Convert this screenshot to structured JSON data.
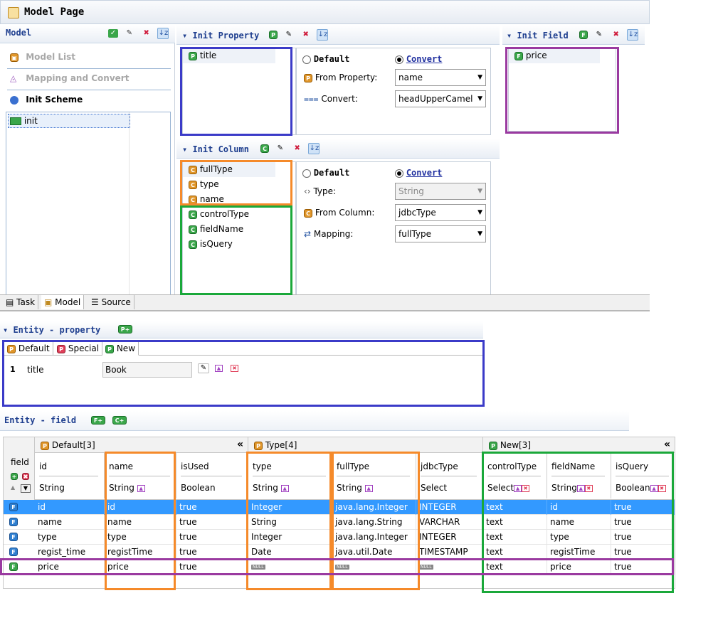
{
  "title": "Model Page",
  "model": {
    "header": "Model",
    "nav": [
      "Model List",
      "Mapping and Convert",
      "Init Scheme"
    ],
    "list": [
      "init"
    ]
  },
  "init_property": {
    "header": "Init Property",
    "items": [
      "title"
    ],
    "default_label": "Default",
    "convert_label": "Convert",
    "from_property_label": "From Property:",
    "from_property_value": "name",
    "convert_field_label": "Convert:",
    "convert_value": "headUpperCamel"
  },
  "init_field": {
    "header": "Init Field",
    "items": [
      "price"
    ]
  },
  "init_column": {
    "header": "Init Column",
    "items_p": [
      "fullType",
      "type",
      "name"
    ],
    "items_c": [
      "controlType",
      "fieldName",
      "isQuery"
    ],
    "default_label": "Default",
    "convert_label": "Convert",
    "type_label": "Type:",
    "type_value": "String",
    "from_column_label": "From Column:",
    "from_column_value": "jdbcType",
    "mapping_label": "Mapping:",
    "mapping_value": "fullType"
  },
  "bottom_tabs": [
    "Task",
    "Model",
    "Source"
  ],
  "entity_property": {
    "header": "Entity - property",
    "tabs": [
      "Default",
      "Special",
      "New"
    ],
    "row_index": "1",
    "row_name": "title",
    "row_value": "Book"
  },
  "entity_field": {
    "header": "Entity - field",
    "field_label": "field",
    "groups": [
      {
        "label": "Default[3]",
        "collapse": "«"
      },
      {
        "label": "Type[4]"
      },
      {
        "label": "New[3]",
        "collapse": "«"
      }
    ],
    "columns": [
      {
        "name": "id",
        "type": "String"
      },
      {
        "name": "name",
        "type": "String"
      },
      {
        "name": "isUsed",
        "type": "Boolean"
      },
      {
        "name": "type",
        "type": "String"
      },
      {
        "name": "fullType",
        "type": "String"
      },
      {
        "name": "jdbcType",
        "type": "Select"
      },
      {
        "name": "controlType",
        "type": "Select"
      },
      {
        "name": "fieldName",
        "type": "String"
      },
      {
        "name": "isQuery",
        "type": "Boolean"
      }
    ],
    "null_text": "NULL",
    "rows": [
      [
        "id",
        "id",
        "true",
        "Integer",
        "java.lang.Integer",
        "INTEGER",
        "text",
        "id",
        "true"
      ],
      [
        "name",
        "name",
        "true",
        "String",
        "java.lang.String",
        "VARCHAR",
        "text",
        "name",
        "true"
      ],
      [
        "type",
        "type",
        "true",
        "Integer",
        "java.lang.Integer",
        "INTEGER",
        "text",
        "type",
        "true"
      ],
      [
        "regist_time",
        "registTime",
        "true",
        "Date",
        "java.util.Date",
        "TIMESTAMP",
        "text",
        "registTime",
        "true"
      ],
      [
        "price",
        "price",
        "true",
        "NULL",
        "NULL",
        "NULL",
        "text",
        "price",
        "true"
      ]
    ]
  },
  "colors": {
    "selection": "#3399ff",
    "highlight_blue": "#3b3bc8",
    "highlight_orange": "#f58a2a",
    "highlight_green": "#1aa83a",
    "highlight_purple": "#9a3aa0"
  }
}
